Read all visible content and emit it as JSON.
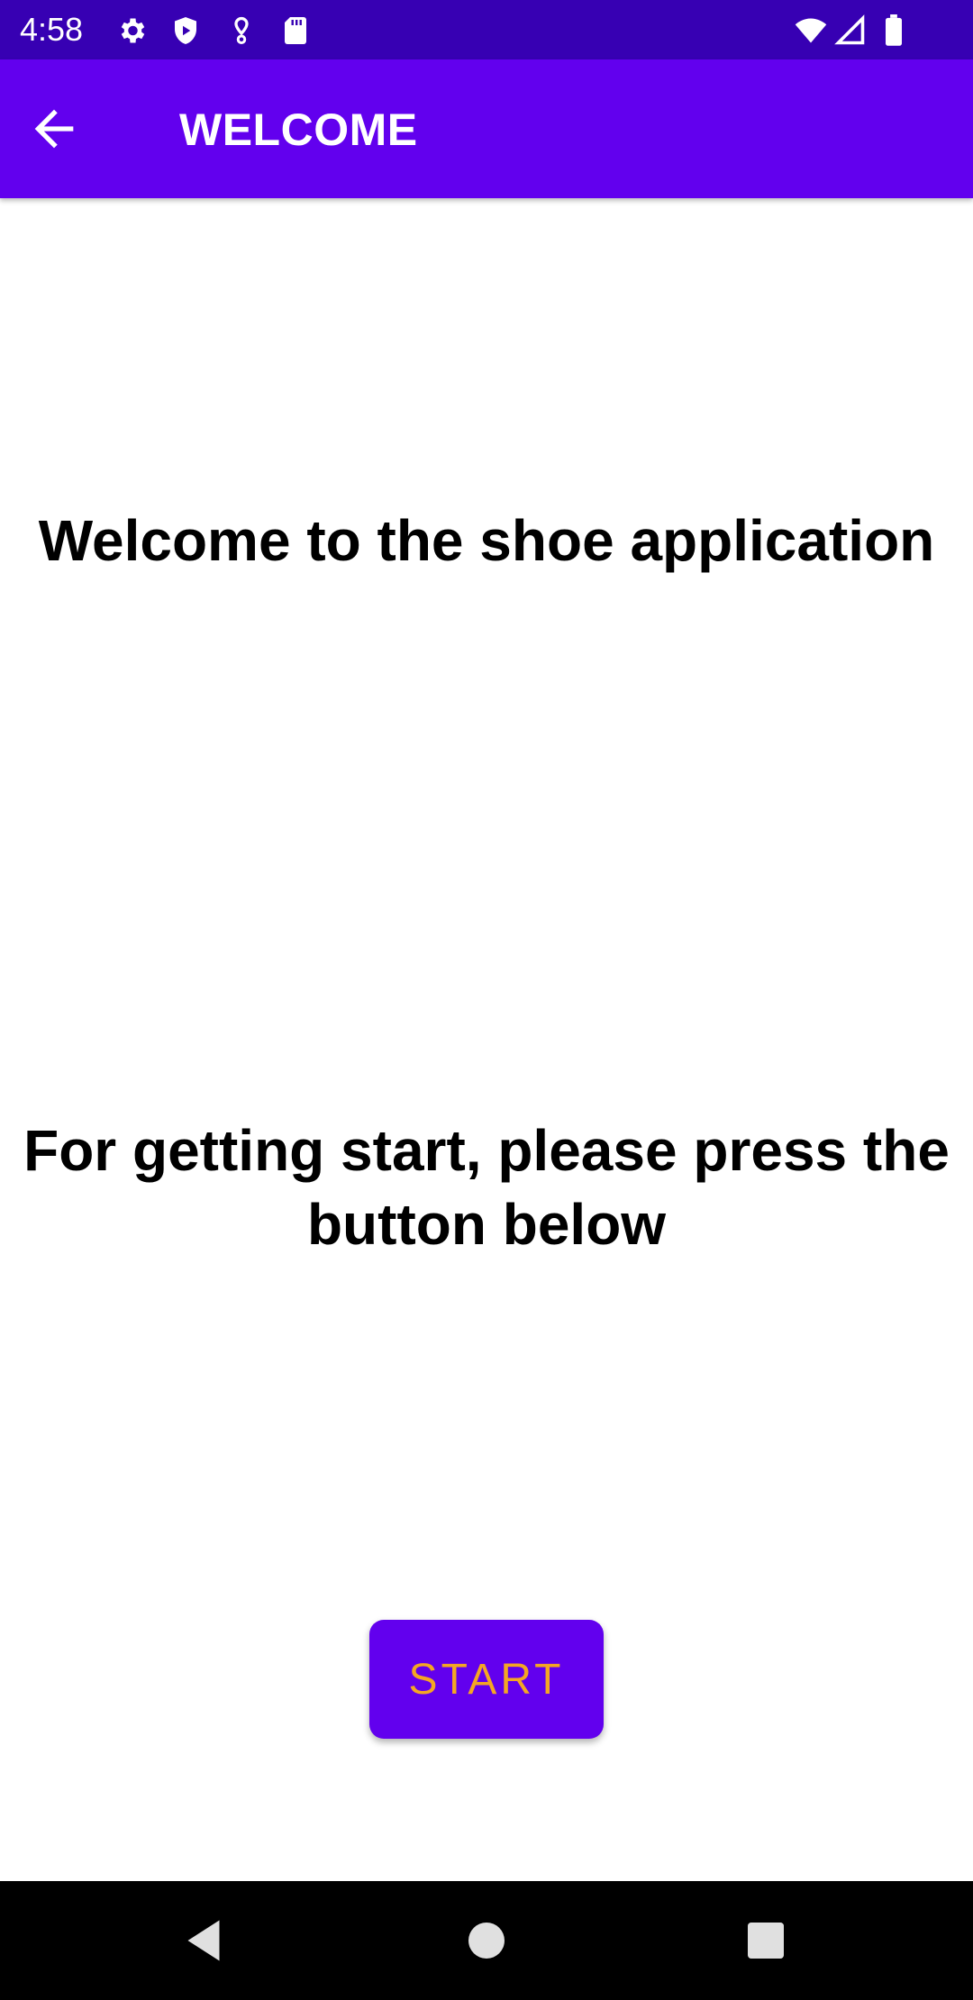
{
  "status_bar": {
    "time": "4:58",
    "icons": [
      "gear-icon",
      "shield-icon",
      "location-pin-icon",
      "sd-card-icon",
      "wifi-icon",
      "cell-signal-icon",
      "battery-icon"
    ],
    "background": "#3700B3"
  },
  "app_bar": {
    "title": "WELCOME",
    "back_icon": "arrow-back-icon",
    "background": "#6200EE"
  },
  "content": {
    "welcome_text": "Welcome to the shoe application",
    "instruction_text": "For getting start, please press the button below"
  },
  "start_button": {
    "label": "START",
    "background": "#6200EE",
    "text_color": "#F4A623"
  },
  "nav_bar": {
    "buttons": [
      "back-triangle-icon",
      "home-circle-icon",
      "recents-square-icon"
    ]
  }
}
